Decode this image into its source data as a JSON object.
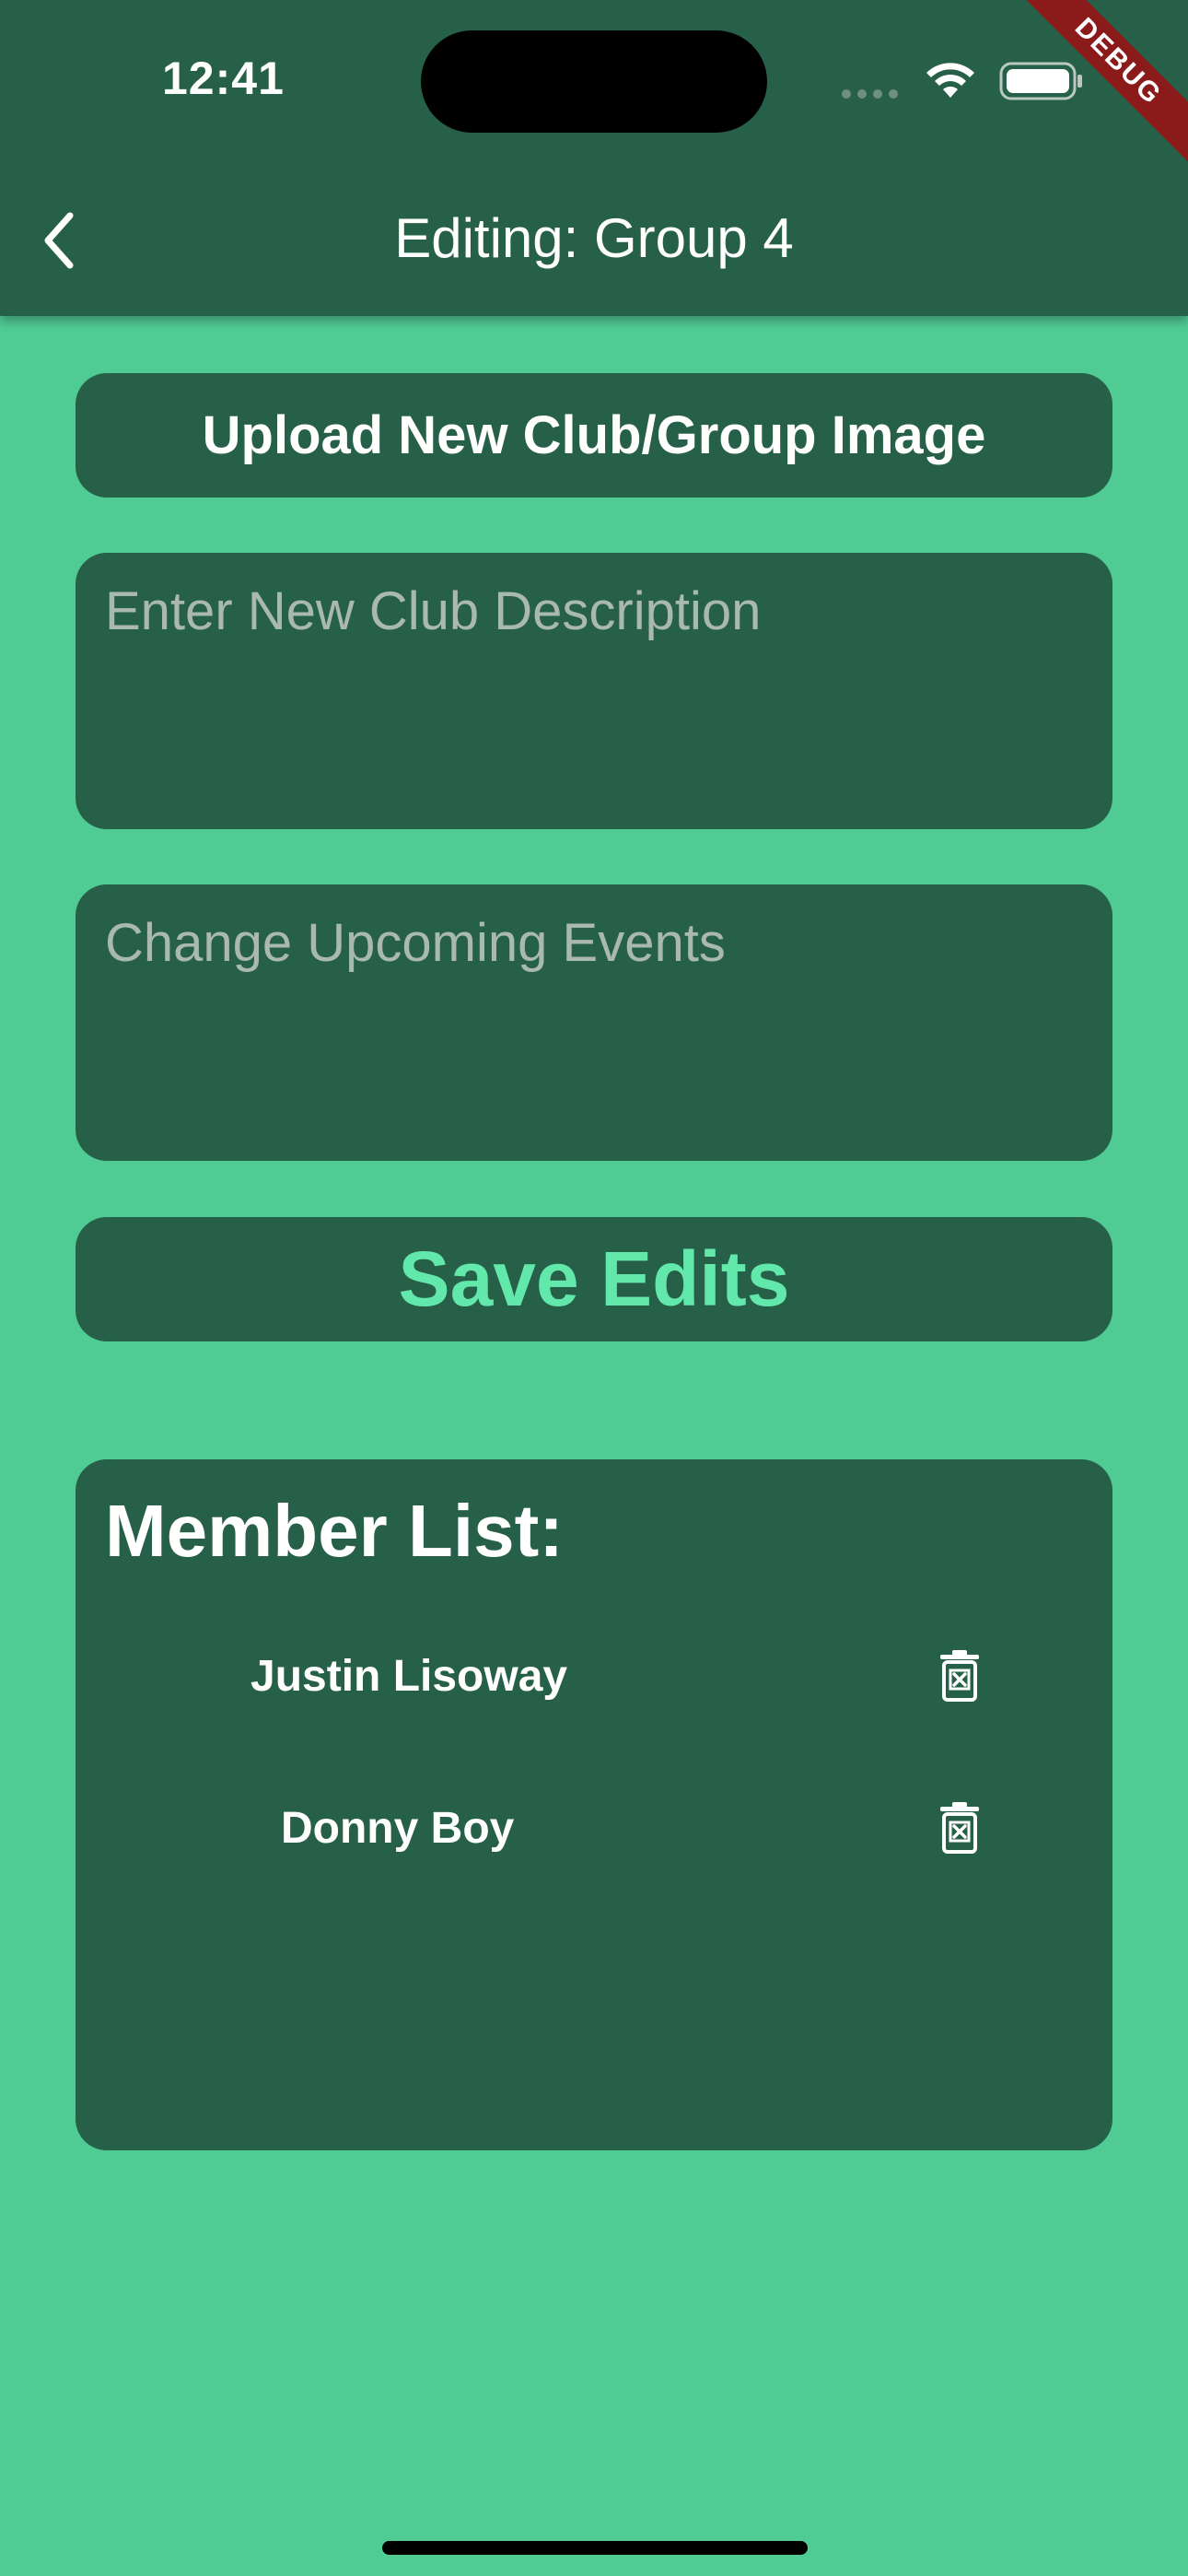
{
  "status_bar": {
    "time": "12:41"
  },
  "debug_banner": "DEBUG",
  "app_bar": {
    "title": "Editing: Group 4",
    "back_icon": "chevron-left-icon"
  },
  "upload_button": {
    "label": "Upload New Club/Group Image"
  },
  "description_field": {
    "placeholder": "Enter New Club Description",
    "value": ""
  },
  "events_field": {
    "placeholder": "Change Upcoming Events",
    "value": ""
  },
  "save_button": {
    "label": "Save Edits"
  },
  "member_list": {
    "title": "Member List:",
    "members": [
      {
        "name": "Justin Lisoway",
        "remove_icon": "trash-x-icon"
      },
      {
        "name": "Donny Boy",
        "remove_icon": "trash-x-icon"
      }
    ]
  },
  "colors": {
    "background": "#51cb94",
    "surface": "#276048",
    "accent": "#63e8ab",
    "placeholder": "#a9b9b1"
  }
}
